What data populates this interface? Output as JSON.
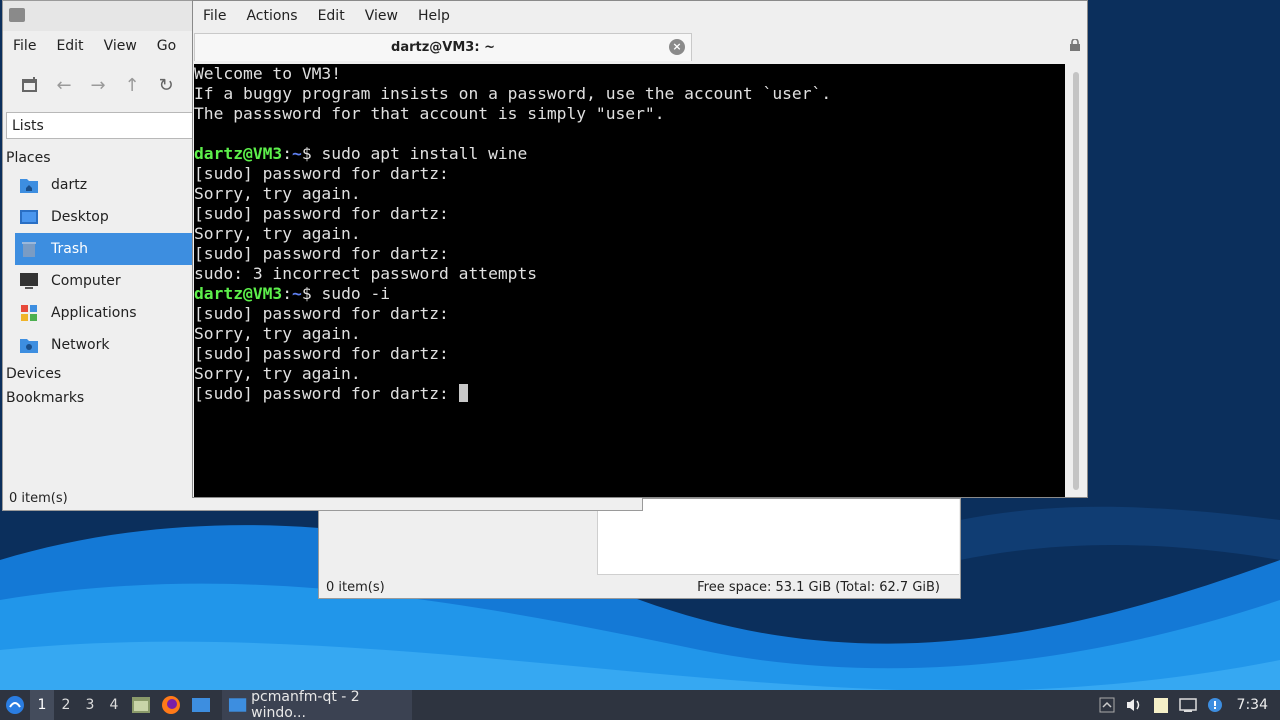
{
  "desktop": {
    "colors": {
      "wallpaper_dark": "#0b2f5c",
      "wallpaper_blue": "#1e90e6"
    }
  },
  "fm_back": {
    "status_left": "0 item(s)",
    "status_right": "Free space: 53.1 GiB (Total: 62.7 GiB)"
  },
  "fm_front": {
    "menu": [
      "File",
      "Edit",
      "View",
      "Go"
    ],
    "lists_label": "Lists",
    "places_heading": "Places",
    "places": [
      {
        "label": "dartz",
        "icon": "home-folder-icon"
      },
      {
        "label": "Desktop",
        "icon": "desktop-icon"
      },
      {
        "label": "Trash",
        "icon": "trash-icon",
        "selected": true
      },
      {
        "label": "Computer",
        "icon": "computer-icon"
      },
      {
        "label": "Applications",
        "icon": "applications-icon"
      },
      {
        "label": "Network",
        "icon": "network-icon"
      }
    ],
    "devices_heading": "Devices",
    "bookmarks_heading": "Bookmarks",
    "status": "0 item(s)"
  },
  "terminal": {
    "menu": [
      "File",
      "Actions",
      "Edit",
      "View",
      "Help"
    ],
    "tab_title": "dartz@VM3: ~",
    "lines": [
      {
        "text": "Welcome to VM3!"
      },
      {
        "text": "If a buggy program insists on a password, use the account `user`."
      },
      {
        "text": "The passsword for that account is simply \"user\"."
      },
      {
        "text": ""
      },
      {
        "user": "dartz@VM3",
        "path": "~",
        "cmd": "$ sudo apt install wine"
      },
      {
        "text": "[sudo] password for dartz:"
      },
      {
        "text": "Sorry, try again."
      },
      {
        "text": "[sudo] password for dartz:"
      },
      {
        "text": "Sorry, try again."
      },
      {
        "text": "[sudo] password for dartz:"
      },
      {
        "text": "sudo: 3 incorrect password attempts"
      },
      {
        "user": "dartz@VM3",
        "path": "~",
        "cmd": "$ sudo -i"
      },
      {
        "text": "[sudo] password for dartz:"
      },
      {
        "text": "Sorry, try again."
      },
      {
        "text": "[sudo] password for dartz:"
      },
      {
        "text": "Sorry, try again."
      },
      {
        "text": "[sudo] password for dartz: ",
        "cursor": true
      }
    ],
    "colors": {
      "user": "#5df04b",
      "path": "#5f80f0",
      "text": "#e0e0e0"
    }
  },
  "taskbar": {
    "workspaces": [
      "1",
      "2",
      "3",
      "4"
    ],
    "active_workspace": "1",
    "task_label": "pcmanfm-qt - 2 windo...",
    "clock": "7:34"
  }
}
